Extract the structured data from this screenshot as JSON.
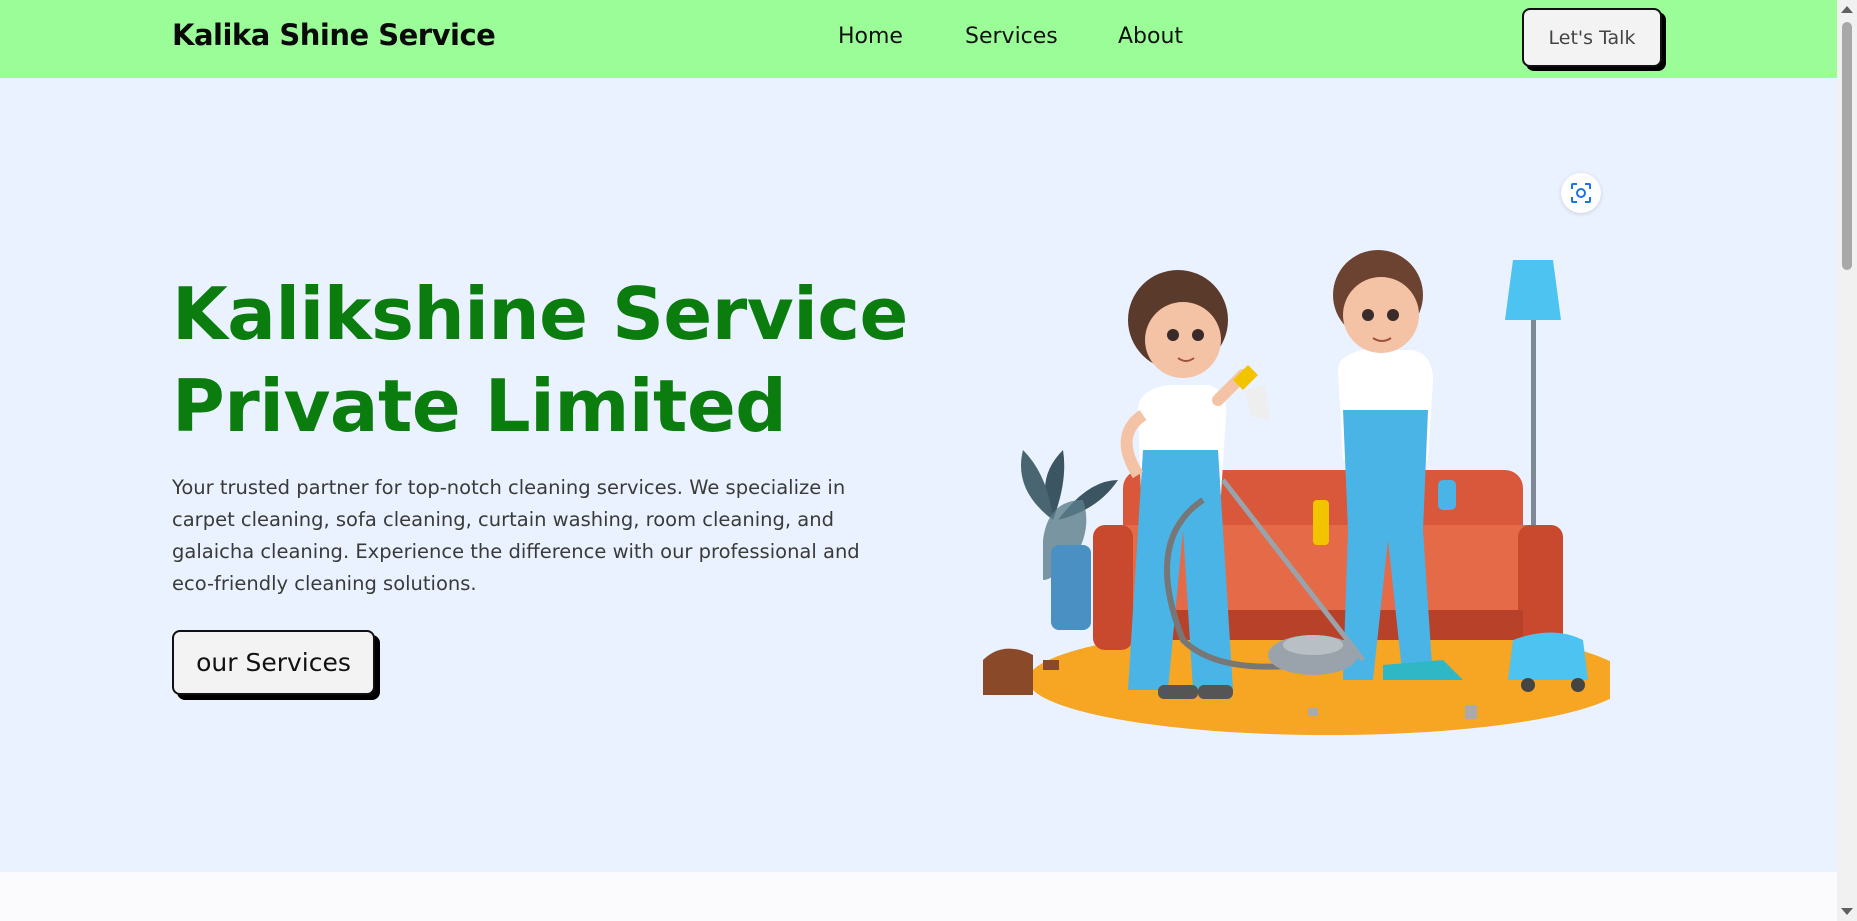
{
  "header": {
    "brand": "Kalika Shine Service",
    "nav": [
      "Home",
      "Services",
      "About"
    ],
    "cta_label": "Let's Talk"
  },
  "hero": {
    "title_line1": "Kalikshine Service",
    "title_line2": "Private Limited",
    "description": "Your trusted partner for top-notch cleaning services. We specialize in carpet cleaning, sofa cleaning, curtain washing, room cleaning, and galaicha cleaning. Experience the difference with our professional and eco-friendly cleaning solutions.",
    "button_label": "our Services",
    "image_alt": "cleaning-illustration",
    "lens_icon": "lens-search-icon"
  },
  "colors": {
    "header_bg": "#9bfd98",
    "page_bg": "#ebf2ff",
    "title_green": "#0b7d0e"
  }
}
